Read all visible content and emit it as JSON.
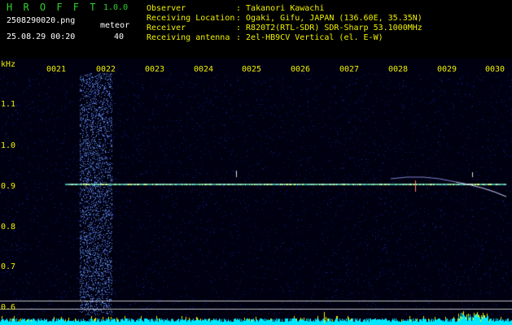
{
  "app": {
    "name": "H R O F F T",
    "version": "1.0.0"
  },
  "file": {
    "name": "2508290020.png",
    "datetime": "25.08.29 00:20"
  },
  "meteor": {
    "label": "meteor",
    "count": "40"
  },
  "info": [
    {
      "key": "Observer",
      "value": ": Takanori Kawachi"
    },
    {
      "key": "Receiving Location",
      "value": ": Ogaki, Gifu, JAPAN (136.60E, 35.35N)"
    },
    {
      "key": "Receiver",
      "value": ": R820T2(RTL-SDR) SDR-Sharp 53.1000MHz"
    },
    {
      "key": "Receiving antenna",
      "value": ": 2el-HB9CV Vertical (el. E-W)"
    }
  ],
  "axis": {
    "unit": "kHz",
    "y_ticks": [
      "1.1",
      "1.0",
      "0.9",
      "0.8",
      "0.7",
      "0.6"
    ],
    "x_ticks": [
      "0021",
      "0022",
      "0023",
      "0024",
      "0025",
      "0026",
      "0027",
      "0028",
      "0029",
      "0030"
    ]
  },
  "colors": {
    "background": "#000000",
    "noise": "#0a1a7a",
    "carrier": "#e8e8a0",
    "label_green": "#2fd12f",
    "label_yellow": "#f0f000",
    "bars_cyan": "#00ffff"
  }
}
